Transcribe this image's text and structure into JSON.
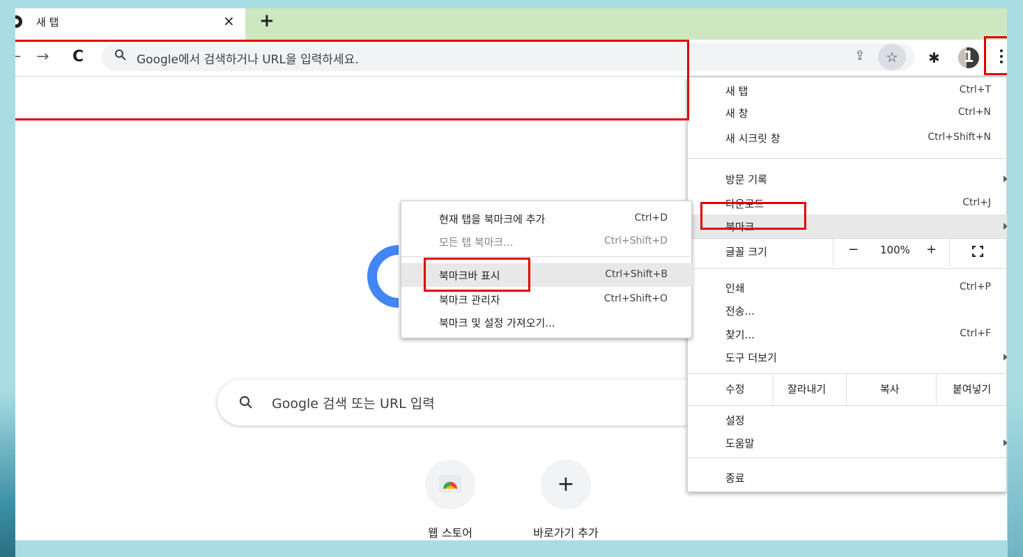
{
  "tab": {
    "title": "새 탭",
    "close": "×",
    "new_tab": "+"
  },
  "toolbar": {
    "omnibox_placeholder": "Google에서 검색하거나 URL을 입력하세요.",
    "avatar_text": "1"
  },
  "ntp": {
    "search_placeholder": "Google 검색 또는 URL 입력",
    "shortcuts": [
      {
        "label": "웹 스토어",
        "icon": "chrome-web-store-icon"
      },
      {
        "label": "바로가기 추가",
        "icon": "plus-icon",
        "glyph": "+"
      }
    ]
  },
  "menu": {
    "items_top": [
      {
        "label": "새 탭",
        "shortcut": "Ctrl+T"
      },
      {
        "label": "새 창",
        "shortcut": "Ctrl+N"
      },
      {
        "label": "새 시크릿 창",
        "shortcut": "Ctrl+Shift+N"
      }
    ],
    "items_mid": [
      {
        "label": "방문 기록",
        "shortcut": ""
      },
      {
        "label": "다운로드",
        "shortcut": "Ctrl+J"
      },
      {
        "label": "북마크",
        "shortcut": ""
      }
    ],
    "zoom": {
      "label": "글꼴 크기",
      "minus": "−",
      "value": "100%",
      "plus": "+"
    },
    "items_tools": [
      {
        "label": "인쇄",
        "shortcut": "Ctrl+P"
      },
      {
        "label": "전송...",
        "shortcut": ""
      },
      {
        "label": "찾기...",
        "shortcut": "Ctrl+F"
      },
      {
        "label": "도구 더보기",
        "shortcut": ""
      }
    ],
    "edit": {
      "label": "수정",
      "cut": "잘라내기",
      "copy": "복사",
      "paste": "붙여넣기"
    },
    "items_bottom": [
      {
        "label": "설정"
      },
      {
        "label": "도움말"
      }
    ],
    "exit": "종료"
  },
  "submenu": {
    "items": [
      {
        "label": "현재 탭을 북마크에 추가",
        "shortcut": "Ctrl+D"
      },
      {
        "label": "모든 탭 북마크...",
        "shortcut": "Ctrl+Shift+D"
      },
      {
        "label": "북마크바 표시",
        "shortcut": "Ctrl+Shift+B"
      },
      {
        "label": "북마크 관리자",
        "shortcut": "Ctrl+Shift+O"
      },
      {
        "label": "북마크 및 설정 가져오기...",
        "shortcut": ""
      }
    ]
  },
  "colors": {
    "highlight": "#e00000",
    "tabstrip": "#cde8c0",
    "frame": "#a9dde4",
    "google_blue": "#4285f4"
  }
}
